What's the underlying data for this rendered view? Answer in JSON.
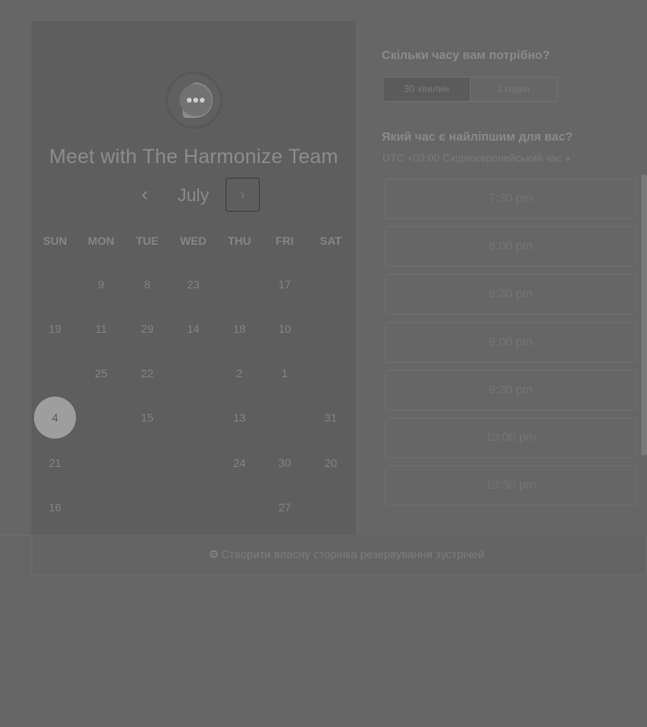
{
  "calendar": {
    "title": "Meet with The Harmonize Team",
    "month": "July",
    "prev_icon": "‹",
    "next_icon": "›",
    "weekdays": [
      "SUN",
      "MON",
      "TUE",
      "WED",
      "THU",
      "FRI",
      "SAT"
    ],
    "rows": [
      [
        "",
        "9",
        "8",
        "23",
        "",
        "17",
        ""
      ],
      [
        "19",
        "11",
        "29",
        "14",
        "18",
        "10",
        ""
      ],
      [
        "",
        "25",
        "22",
        "",
        "2",
        "1",
        ""
      ],
      [
        "4",
        "",
        "15",
        "",
        "13",
        "",
        "31"
      ],
      [
        "21",
        "",
        "",
        "",
        "24",
        "30",
        "20"
      ],
      [
        "16",
        "",
        "",
        "",
        "",
        "27",
        ""
      ]
    ],
    "selected_day": "4"
  },
  "duration": {
    "question": "Скільки часу вам потрібно?",
    "options": [
      "30 хвилин",
      "1 годин"
    ],
    "selected": "30 хвилин"
  },
  "time": {
    "question": "Який час є найліпшим для вас?",
    "timezone": "UTC +03:00 Східноєвропейський час",
    "slots": [
      "7:30 pm",
      "8:00 pm",
      "8:30 pm",
      "9:00 pm",
      "9:30 pm",
      "10:00 pm",
      "10:30 pm"
    ]
  },
  "footer": {
    "link_text": "Створити власну сторінка резервування зустрічей"
  },
  "icons": {
    "logo": "chat-bubble-logo-icon",
    "caret": "caret-down-icon",
    "sprocket": "hubspot-sprocket-icon"
  }
}
